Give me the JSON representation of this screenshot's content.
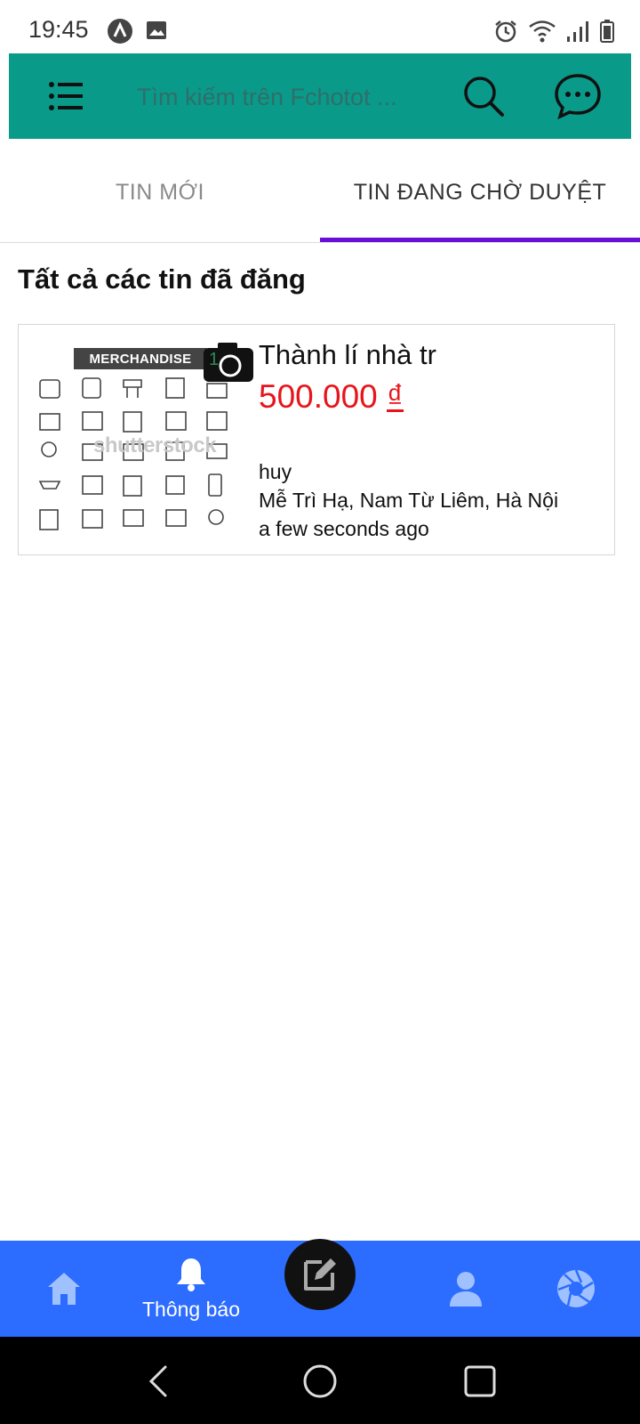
{
  "status_bar": {
    "time": "19:45"
  },
  "top_bar": {
    "search_placeholder": "Tìm kiếm trên Fchotot ..."
  },
  "tabs": [
    {
      "label": "TIN MỚI",
      "active": false
    },
    {
      "label": "TIN ĐANG CHỜ DUYỆT",
      "active": true
    }
  ],
  "colors": {
    "top_bar": "#0a9a8a",
    "tab_indicator": "#6a0dd8",
    "price": "#e8141b",
    "bottom_nav": "#2c6cff"
  },
  "section": {
    "title": "Tất cả các tin đã đăng"
  },
  "listing": {
    "image_banner_text": "MERCHANDISE",
    "image_watermark": "shutterstock",
    "image_count": "1",
    "title": "Thành lí nhà tr",
    "price_value": "500.000",
    "price_currency": "₫",
    "seller": "huy",
    "location": "Mễ Trì Hạ, Nam Từ Liêm, Hà Nội",
    "posted": "a few seconds ago"
  },
  "bottom_nav": {
    "items": [
      {
        "icon": "home-icon"
      },
      {
        "icon": "bell-icon",
        "label": "Thông báo"
      },
      {
        "icon": "edit-icon"
      },
      {
        "icon": "user-icon"
      },
      {
        "icon": "aperture-icon"
      }
    ]
  }
}
